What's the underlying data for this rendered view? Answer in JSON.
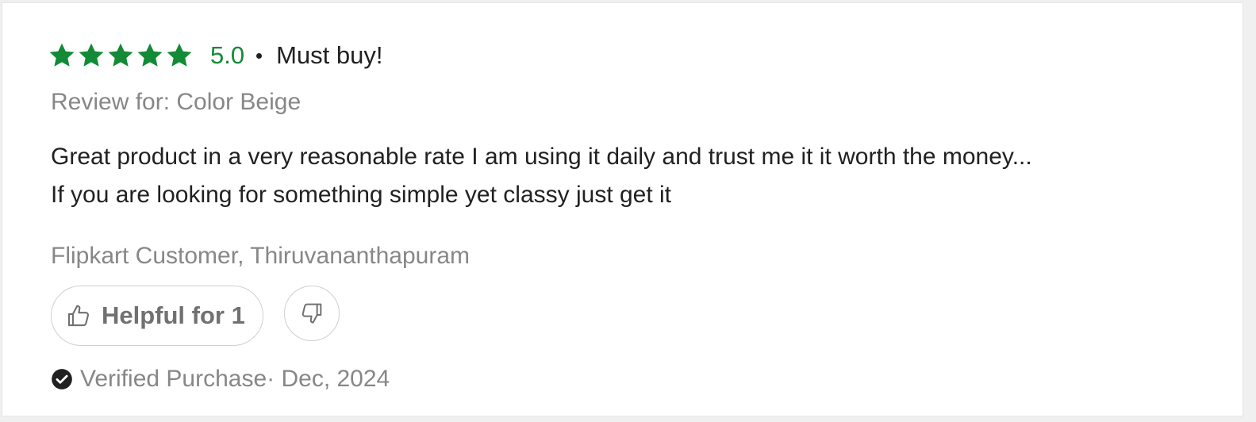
{
  "review": {
    "rating": {
      "value": "5.0",
      "stars_filled": 5,
      "stars_total": 5,
      "color": "#138a36"
    },
    "headline": "Must buy!",
    "variant": "Review for: Color Beige",
    "body_lines": [
      "Great product in a very reasonable rate I am using it daily and trust me it it worth the money...",
      "If you are looking for something simple yet classy just get it"
    ],
    "author": "Flipkart Customer, Thiruvananthapuram",
    "helpful": {
      "label": "Helpful for 1",
      "icon": "thumbs-up-icon"
    },
    "dislike": {
      "icon": "thumbs-down-icon"
    },
    "verified": {
      "label": "Verified Purchase",
      "date": "· Dec, 2024",
      "icon": "check-circle-icon"
    }
  }
}
